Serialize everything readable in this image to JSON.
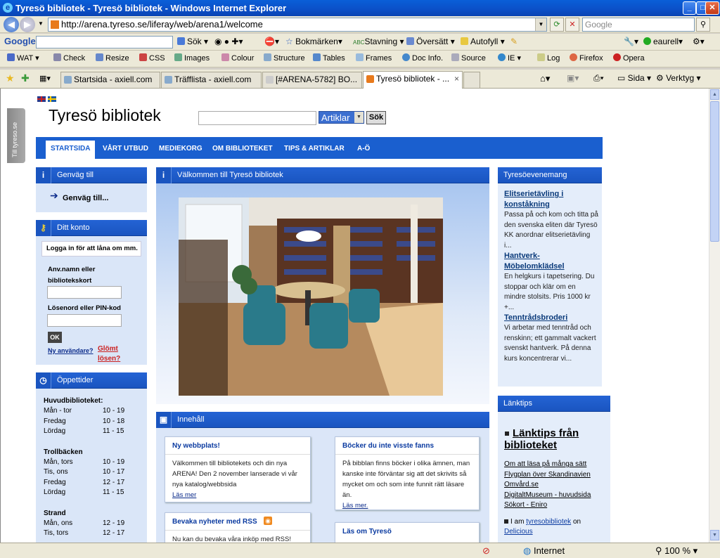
{
  "window": {
    "title": "Tyresö bibliotek - Tyresö bibliotek - Windows Internet Explorer"
  },
  "address": {
    "url": "http://arena.tyreso.se/liferay/web/arena1/welcome",
    "search_placeholder": "Google"
  },
  "google_bar": {
    "logo": "Google",
    "items": [
      "Sök",
      "Bokmärken",
      "Stavning",
      "Översätt",
      "Autofyll",
      "eaurell"
    ]
  },
  "dev_toolbar": {
    "items": [
      "WAT",
      "Check",
      "Resize",
      "CSS",
      "Images",
      "Colour",
      "Structure",
      "Tables",
      "Frames",
      "Doc Info.",
      "Source",
      "IE",
      "Log",
      "Firefox",
      "Opera"
    ]
  },
  "tabs": [
    {
      "label": "Startsida - axiell.com"
    },
    {
      "label": "Träfflista - axiell.com"
    },
    {
      "label": "[#ARENA-5782] BO..."
    },
    {
      "label": "Tyresö bibliotek - ..."
    }
  ],
  "cmdbar": {
    "page": "Sida",
    "tools": "Verktyg"
  },
  "status": {
    "zone": "Internet",
    "zoom": "100 %"
  },
  "site": {
    "side_tab": "Till tyreso.se",
    "title": "Tyresö bibliotek",
    "search_select": "Artiklar",
    "search_button": "Sök",
    "menu": [
      "STARTSIDA",
      "VÅRT UTBUD",
      "MEDIEKORG",
      "OM BIBLIOTEKET",
      "TIPS & ARTIKLAR",
      "A-Ö"
    ],
    "shortcut": {
      "header": "Genväg till",
      "link": "Genväg till..."
    },
    "account": {
      "header": "Ditt konto",
      "info": "Logga in för att låna om mm.",
      "user_label_1": "Anv.namn eller",
      "user_label_2": "bibliotekskort",
      "pin_label": "Lösenord eller PIN-kod",
      "ok": "OK",
      "new_user": "Ny användare?",
      "forgot_1": "Glömt",
      "forgot_2": "lösen?"
    },
    "hours": {
      "header": "Öppettider",
      "groups": [
        {
          "name": "Huvudbiblioteket:",
          "rows": [
            [
              "Mån - tor",
              "10 - 19"
            ],
            [
              "Fredag",
              "10 - 18"
            ],
            [
              "Lördag",
              "11 - 15"
            ]
          ]
        },
        {
          "name": "Trollbäcken",
          "rows": [
            [
              "Mån, tors",
              "10 - 19"
            ],
            [
              "Tis, ons",
              "10 - 17"
            ],
            [
              "Fredag",
              "12 - 17"
            ],
            [
              "Lördag",
              "11 - 15"
            ]
          ]
        },
        {
          "name": "Strand",
          "rows": [
            [
              "Mån, ons",
              "12 - 19"
            ],
            [
              "Tis, tors",
              "12 - 17"
            ]
          ]
        }
      ]
    },
    "welcome": {
      "header": "Välkommen till Tyresö bibliotek"
    },
    "content": {
      "header": "Innehåll",
      "cards": [
        {
          "title": "Ny webbplats!",
          "body": "Välkommen till bibliotekets och din nya ARENA! Den 2 november lanserade vi vår nya katalog/webbsida",
          "more": "Läs mer"
        },
        {
          "title": "Böcker du inte visste fanns",
          "body": "På bibblan finns böcker i olika ämnen, man kanske inte förväntar sig att det skrivits så mycket om och som inte funnit rätt läsare än.",
          "more": "Läs mer."
        },
        {
          "title": "Bevaka nyheter med RSS",
          "body": "Nu kan du bevaka våra inköp med RSS!"
        },
        {
          "title": "Läs om Tyresö"
        }
      ]
    },
    "events": {
      "header": "Tyresöevenemang",
      "items": [
        {
          "title": "Elitserietävling i konståkning",
          "desc": "Passa på och kom och titta på den svenska eliten där Tyresö KK anordnar elitserietävling i..."
        },
        {
          "title": "Hantverk-Möbelomklädsel",
          "desc": "En helgkurs i tapetsering. Du stoppar och klär om en mindre stolsits. Pris 1000 kr +..."
        },
        {
          "title": "Tenntrådsbroderi",
          "desc": "Vi arbetar med tenntråd och renskinn; ett gammalt vackert svenskt hantverk. På denna kurs koncentrerar vi..."
        }
      ]
    },
    "links": {
      "header": "Länktips",
      "title": "Länktips från biblioteket",
      "items": [
        "Om att läsa på många sätt",
        "Flygplan över Skandinavien",
        "Omvård.se",
        "DigitaltMuseum - huvudsida",
        "Sökort - Eniro"
      ],
      "tail_prefix": "I am",
      "tail_link": "tyresobibliotek",
      "tail_suffix": "on",
      "tail_link2": "Delicious"
    }
  }
}
